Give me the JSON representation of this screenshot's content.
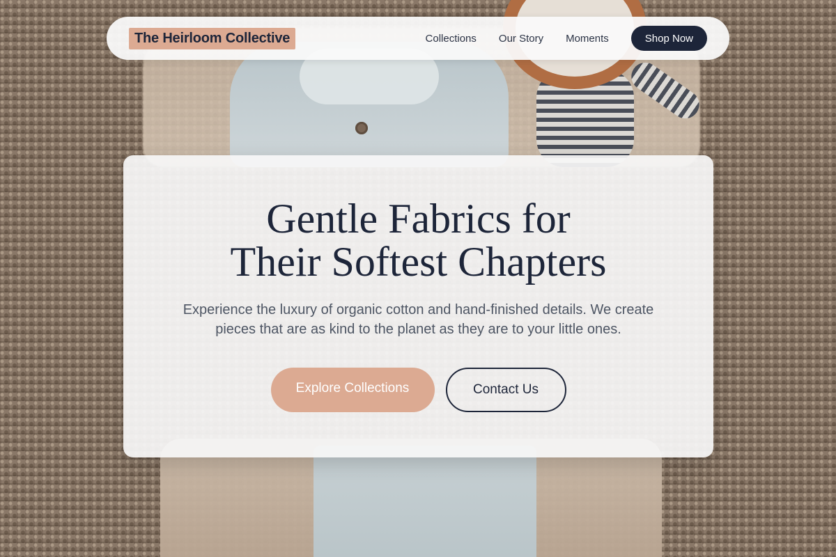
{
  "brand": {
    "name": "The Heirloom Collective"
  },
  "nav": {
    "links": [
      {
        "label": "Collections"
      },
      {
        "label": "Our Story"
      },
      {
        "label": "Moments"
      }
    ],
    "cta_label": "Shop Now"
  },
  "hero": {
    "title": "Gentle Fabrics for Their Softest Chapters",
    "subtitle": "Experience the luxury of organic cotton and hand-finished details. We create pieces that are as kind to the planet as they are to your little ones.",
    "primary_label": "Explore Collections",
    "secondary_label": "Contact Us"
  },
  "colors": {
    "accent": "#dcaa92",
    "navy": "#1d2539",
    "body_text": "#4d5563"
  },
  "background": {
    "icon": "baby-clothes-flatlay-photo"
  }
}
